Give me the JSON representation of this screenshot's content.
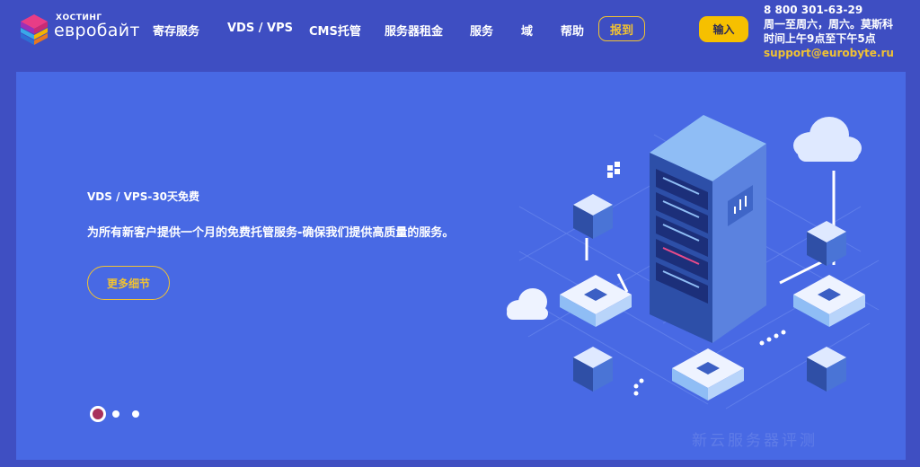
{
  "header": {
    "logo": {
      "small_text": "ХОСТИНГ",
      "big_text": "евробайт"
    },
    "nav": [
      {
        "label": "寄存服务"
      },
      {
        "label": "VDS / VPS"
      },
      {
        "label": "CMS托管"
      },
      {
        "label": "服务器租金"
      },
      {
        "label": "服务"
      },
      {
        "label": "域"
      },
      {
        "label": "帮助"
      }
    ],
    "register_label": "报到",
    "login_label": "输入",
    "contact": {
      "phone": "8 800 301-63-29",
      "hours_line1": "周一至周六，周六。莫斯科",
      "hours_line2": "时间上午9点至下午5点",
      "email": "support@eurobyte.ru"
    }
  },
  "hero": {
    "title": "VDS / VPS-30天免费",
    "description": "为所有新客户提供一个月的免费托管服务-确保我们提供高质量的服务。",
    "more_label": "更多细节",
    "slides": {
      "count": 3,
      "active": 1
    },
    "watermark": "新云服务器评测"
  },
  "colors": {
    "header_bg": "#3e4ec2",
    "hero_bg": "#4869e4",
    "accent_yellow": "#f6c000",
    "outline_gold": "#f1c232",
    "active_dot": "#a8305c"
  },
  "icons": [
    "cube-logo-icon",
    "server-rack-icon",
    "cloud-icon",
    "server-node-icon",
    "network-cube-icon"
  ]
}
